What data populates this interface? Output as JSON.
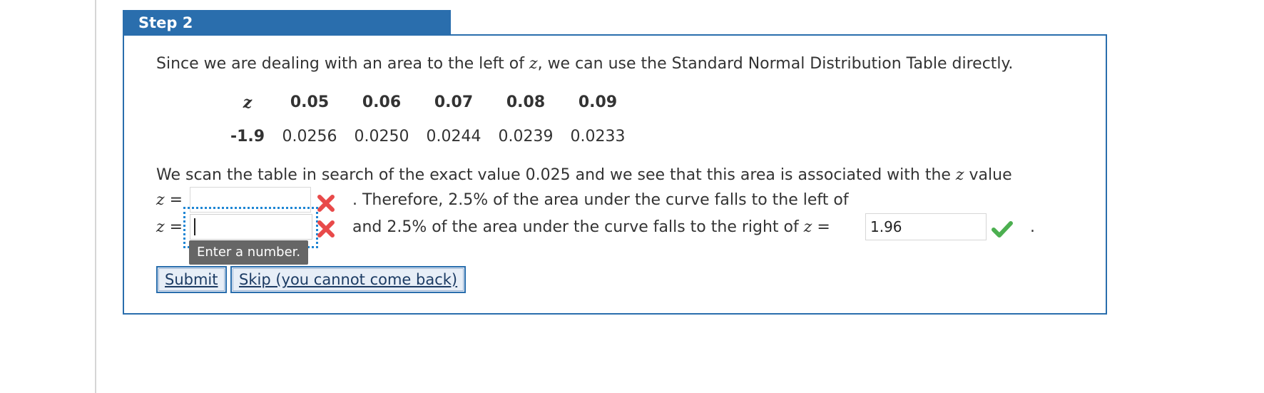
{
  "step": {
    "title": "Step 2"
  },
  "intro": {
    "before": "Since we are dealing with an area to the left of ",
    "z": "z",
    "after": ", we can use the Standard Normal Distribution Table directly."
  },
  "table": {
    "header_z": "z",
    "columns": [
      "0.05",
      "0.06",
      "0.07",
      "0.08",
      "0.09"
    ],
    "row_label": "-1.9",
    "values": [
      "0.0256",
      "0.0250",
      "0.0244",
      "0.0239",
      "0.0233"
    ]
  },
  "scan": {
    "before": "We scan the table in search of the exact value 0.025 and we see that this area is associated with the ",
    "z": "z",
    "after": " value"
  },
  "line1": {
    "z": "z",
    "eq": " =",
    "input_value": "",
    "text": ". Therefore, 2.5% of the area under the curve falls to the left of"
  },
  "line2": {
    "z": "z",
    "eq": " =",
    "input_value": "",
    "text_before": "and 2.5% of the area under the curve falls to the right of ",
    "z2": "z",
    "text_eq": " =",
    "answer_value": "1.96",
    "period": "."
  },
  "tooltip": {
    "text": "Enter a number."
  },
  "buttons": {
    "submit": "Submit",
    "skip": "Skip (you cannot come back)"
  },
  "icons": {
    "incorrect": "x-mark-icon",
    "correct": "check-mark-icon"
  },
  "colors": {
    "header_blue": "#2a6ead",
    "incorrect_red": "#e84a4a",
    "correct_green": "#4caf50",
    "focus_blue": "#1f86d4"
  }
}
